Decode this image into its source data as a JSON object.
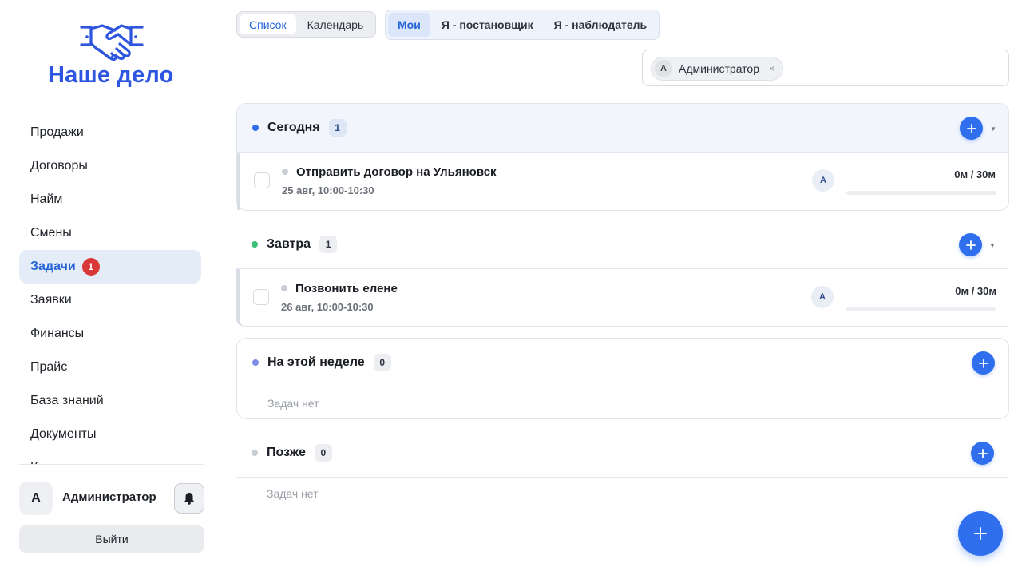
{
  "brand": {
    "name": "Наше дело",
    "color": "#2d55e0",
    "logo_icon": "handshake-icon"
  },
  "sidebar": {
    "items": [
      {
        "label": "Продажи"
      },
      {
        "label": "Договоры"
      },
      {
        "label": "Найм"
      },
      {
        "label": "Смены"
      },
      {
        "label": "Задачи",
        "active": true,
        "badge": "1"
      },
      {
        "label": "Заявки"
      },
      {
        "label": "Финансы"
      },
      {
        "label": "Прайс"
      },
      {
        "label": "База знаний"
      },
      {
        "label": "Документы"
      },
      {
        "label": "К"
      }
    ],
    "user": {
      "initial": "A",
      "name": "Администратор"
    },
    "bell_icon": "bell-icon",
    "logout_label": "Выйти"
  },
  "view_tabs": [
    {
      "label": "Список",
      "active": true
    },
    {
      "label": "Календарь"
    }
  ],
  "filter_tabs": [
    {
      "label": "Мои",
      "active": true
    },
    {
      "label": "Я - постановщик"
    },
    {
      "label": "Я - наблюдатель"
    }
  ],
  "assignee_filter": {
    "initial": "A",
    "name": "Администратор",
    "remove": "×"
  },
  "groups": [
    {
      "title": "Сегодня",
      "count": "1",
      "dot_color": "#2f6fed",
      "tasks": [
        {
          "title": "Отправить договор на Ульяновск",
          "date": "25 авг, 10:00-10:30",
          "assignee": "A",
          "time": "0м / 30м",
          "progress": 0
        }
      ]
    },
    {
      "title": "Завтра",
      "count": "1",
      "dot_color": "#3cc07a",
      "tasks": [
        {
          "title": "Позвонить елене",
          "date": "26 авг, 10:00-10:30",
          "assignee": "A",
          "time": "0м / 30м",
          "progress": 0
        }
      ]
    },
    {
      "title": "На этой неделе",
      "count": "0",
      "dot_color": "#7c8ce8",
      "empty": "Задач нет"
    },
    {
      "title": "Позже",
      "count": "0",
      "dot_color": "#c9ced6",
      "empty": "Задач нет"
    }
  ],
  "accent": "#2f6fed"
}
